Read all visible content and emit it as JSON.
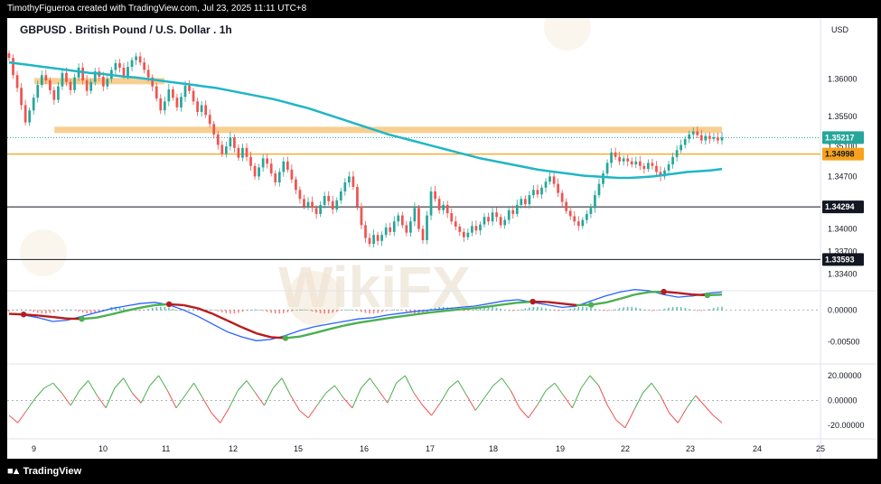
{
  "header": {
    "credit": "TimothyFigueroa created with TradingView.com, Jul 23, 2025 11:11 UTC+8"
  },
  "footer": {
    "brand": "TradingView"
  },
  "watermark": {
    "text": "WikiFX"
  },
  "chart_data": {
    "type": "candlestick",
    "title": "GBPUSD . British Pound / U.S. Dollar . 1h",
    "currency": "USD",
    "colors": {
      "up": "#26a69a",
      "down": "#ef5350",
      "ma": "#1fb6c4",
      "zone": "#f7c77e",
      "last_price_tag": "#26a69a",
      "level_tag_orange": "#f7a21b",
      "level_tag_black": "#131722",
      "macd_line": "#2962ff",
      "signal_up": "#4caf50",
      "signal_down": "#b71c1c",
      "osc_up": "#4caf50",
      "osc_down": "#ef5350"
    },
    "price_axis": {
      "ticks": [
        "1.36000",
        "1.35500",
        "1.35100",
        "1.34700",
        "1.34000",
        "1.33700",
        "1.33400"
      ],
      "range": [
        1.332,
        1.3645
      ]
    },
    "time_axis": {
      "labels": [
        "9",
        "10",
        "11",
        "12",
        "15",
        "16",
        "17",
        "18",
        "19",
        "22",
        "23",
        "24",
        "25"
      ]
    },
    "price_tags": [
      {
        "label": "1.35217",
        "price": 1.35217,
        "style": "last"
      },
      {
        "label": "1.34998",
        "price": 1.34998,
        "style": "orange"
      },
      {
        "label": "1.34294",
        "price": 1.34294,
        "style": "black"
      },
      {
        "label": "1.33593",
        "price": 1.33593,
        "style": "black"
      }
    ],
    "zones": [
      {
        "price": 1.3597,
        "from_day": 0,
        "to_day": 2.0
      },
      {
        "price": 1.3532,
        "from_day": 0.3,
        "to_day": 10.5
      }
    ],
    "close_series": [
      1.3628,
      1.3605,
      1.3588,
      1.3565,
      1.3542,
      1.3558,
      1.3575,
      1.3592,
      1.3605,
      1.3598,
      1.3585,
      1.3572,
      1.359,
      1.3608,
      1.3596,
      1.3585,
      1.3602,
      1.3615,
      1.3598,
      1.3584,
      1.3596,
      1.361,
      1.3603,
      1.359,
      1.36,
      1.3612,
      1.3621,
      1.3615,
      1.3604,
      1.3616,
      1.3625,
      1.363,
      1.3622,
      1.3612,
      1.3602,
      1.359,
      1.3574,
      1.3558,
      1.357,
      1.3586,
      1.3575,
      1.3562,
      1.3576,
      1.3591,
      1.3584,
      1.357,
      1.3556,
      1.3565,
      1.3552,
      1.354,
      1.3526,
      1.3512,
      1.35,
      1.351,
      1.3522,
      1.3508,
      1.3495,
      1.3508,
      1.3496,
      1.3484,
      1.347,
      1.3482,
      1.3494,
      1.3487,
      1.3474,
      1.3462,
      1.3476,
      1.349,
      1.3479,
      1.3466,
      1.3452,
      1.344,
      1.343,
      1.3436,
      1.3428,
      1.342,
      1.3432,
      1.3444,
      1.3437,
      1.3426,
      1.3438,
      1.345,
      1.3462,
      1.347,
      1.3456,
      1.343,
      1.3405,
      1.3388,
      1.338,
      1.3392,
      1.3384,
      1.3392,
      1.3402,
      1.3396,
      1.341,
      1.3418,
      1.3405,
      1.3395,
      1.341,
      1.3428,
      1.34,
      1.3385,
      1.3418,
      1.345,
      1.344,
      1.3425,
      1.3432,
      1.3421,
      1.341,
      1.3403,
      1.3396,
      1.3389,
      1.3395,
      1.3404,
      1.3398,
      1.3406,
      1.3416,
      1.341,
      1.3422,
      1.3416,
      1.3405,
      1.3412,
      1.3425,
      1.342,
      1.3432,
      1.344,
      1.3433,
      1.3445,
      1.3452,
      1.3446,
      1.3455,
      1.3463,
      1.347,
      1.346,
      1.3448,
      1.3436,
      1.3424,
      1.3417,
      1.341,
      1.3404,
      1.3412,
      1.342,
      1.3428,
      1.3445,
      1.346,
      1.3474,
      1.3488,
      1.3502,
      1.3496,
      1.349,
      1.3494,
      1.349,
      1.3486,
      1.349,
      1.3484,
      1.348,
      1.3488,
      1.3484,
      1.3476,
      1.347,
      1.3478,
      1.3486,
      1.3496,
      1.3505,
      1.3512,
      1.352,
      1.3526,
      1.353,
      1.3525,
      1.3518,
      1.3524,
      1.352,
      1.3522,
      1.3518,
      1.3522
    ],
    "ma_series": [
      1.3622,
      1.362,
      1.3618,
      1.3616,
      1.3614,
      1.3612,
      1.361,
      1.3608,
      1.3607,
      1.3605,
      1.3603,
      1.3602,
      1.36,
      1.3598,
      1.3596,
      1.3594,
      1.3592,
      1.359,
      1.3588,
      1.3585,
      1.3582,
      1.3579,
      1.3576,
      1.3573,
      1.3569,
      1.3565,
      1.3561,
      1.3556,
      1.3551,
      1.3546,
      1.3541,
      1.3536,
      1.3531,
      1.3526,
      1.3522,
      1.3518,
      1.3514,
      1.351,
      1.3506,
      1.3502,
      1.3498,
      1.3494,
      1.3491,
      1.3488,
      1.3485,
      1.3482,
      1.3479,
      1.3477,
      1.3475,
      1.3473,
      1.3471,
      1.347,
      1.3469,
      1.3468,
      1.3468,
      1.3469,
      1.347,
      1.3472,
      1.3474,
      1.3476,
      1.3477,
      1.3478,
      1.348
    ],
    "macd_axis": {
      "ticks": [
        "0.00000",
        "-0.00500"
      ],
      "range": [
        -0.008,
        0.003
      ]
    },
    "macd_line": [
      -0.0006,
      -0.0008,
      -0.0012,
      -0.0018,
      -0.0016,
      -0.001,
      -0.0004,
      0.0002,
      0.0006,
      0.001,
      0.0012,
      0.0008,
      0.0,
      -0.001,
      -0.0022,
      -0.0034,
      -0.0042,
      -0.0048,
      -0.0046,
      -0.004,
      -0.0032,
      -0.0026,
      -0.0022,
      -0.0018,
      -0.0014,
      -0.0012,
      -0.0008,
      -0.0005,
      -0.0002,
      0.0,
      0.0002,
      0.0004,
      0.0006,
      0.001,
      0.0014,
      0.0016,
      0.0012,
      0.0008,
      0.0004,
      0.0006,
      0.0014,
      0.0022,
      0.0028,
      0.0032,
      0.003,
      0.0024,
      0.002,
      0.0022,
      0.0026,
      0.0028
    ],
    "osc_axis": {
      "ticks": [
        "20.00000",
        "0.00000",
        "-20.00000"
      ],
      "range": [
        -28,
        28
      ]
    },
    "osc_series": [
      -12,
      -18,
      -8,
      2,
      10,
      14,
      6,
      -4,
      8,
      16,
      4,
      -6,
      10,
      18,
      6,
      -2,
      12,
      20,
      8,
      -6,
      4,
      14,
      2,
      -10,
      -18,
      -6,
      8,
      16,
      6,
      -4,
      10,
      18,
      4,
      -8,
      -14,
      -4,
      6,
      12,
      2,
      -6,
      10,
      18,
      8,
      -2,
      14,
      20,
      6,
      -4,
      -12,
      -2,
      10,
      16,
      4,
      -8,
      2,
      12,
      18,
      8,
      -6,
      -14,
      -4,
      8,
      14,
      4,
      -6,
      10,
      20,
      12,
      -4,
      -16,
      -22,
      -8,
      6,
      14,
      4,
      -10,
      -18,
      -6,
      4,
      -4,
      -12,
      -18
    ]
  }
}
